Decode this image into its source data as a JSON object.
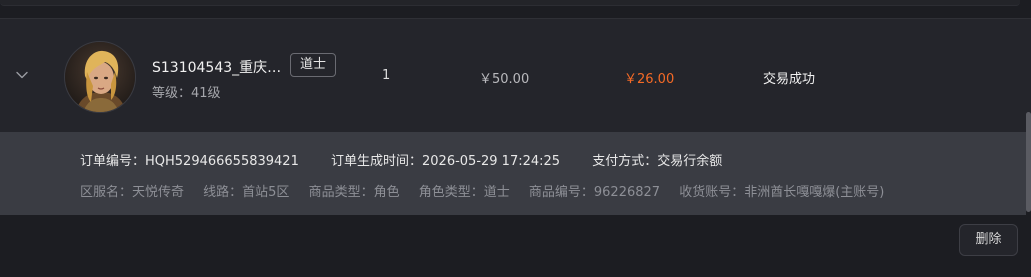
{
  "order": {
    "character_name": "S13104543_重庆…",
    "class_badge": "道士",
    "level": "等级：41级",
    "quantity": "1",
    "unit_price": "￥50.00",
    "total_price": "￥26.00",
    "status": "交易成功"
  },
  "details": {
    "order_no": "订单编号：HQH529466655839421",
    "created_time": "订单生成时间：2026-05-29 17:24:25",
    "payment": "支付方式：交易行余额",
    "server": "区服名：天悦传奇",
    "line": "线路：首站5区",
    "goods_type": "商品类型：角色",
    "role_type": "角色类型：道士",
    "goods_no": "商品编号：96226827",
    "receiver": "收货账号：非洲酋长嘎嘎爆(主账号)"
  },
  "actions": {
    "delete_label": "删除"
  },
  "colors": {
    "accent_price": "#f56a26",
    "background": "#1c1d22",
    "card": "#24252b",
    "details_panel": "#3a3c43"
  },
  "icons": {
    "expand": "chevron-down-icon",
    "avatar": "character-portrait"
  }
}
